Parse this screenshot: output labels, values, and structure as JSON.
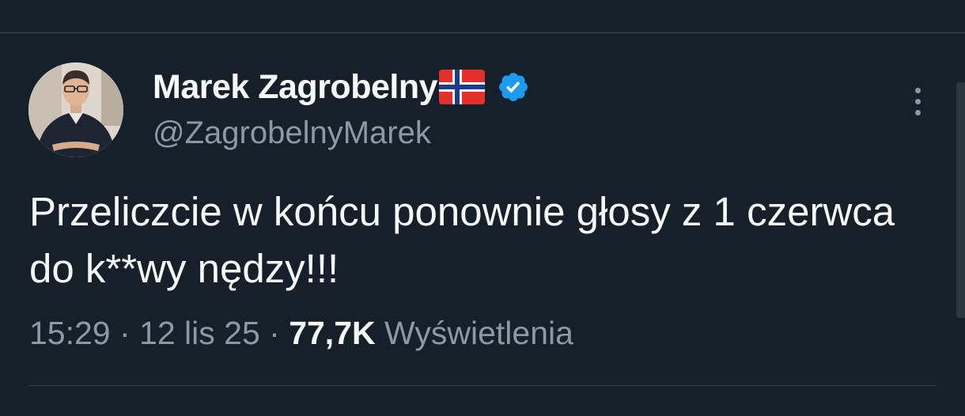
{
  "author": {
    "display_name": "Marek Zagrobelny",
    "flag_icon": "norway-flag-icon",
    "verified_icon": "verified-badge-icon",
    "verified_color": "#1d9bf0",
    "handle": "@ZagrobelnyMarek"
  },
  "tweet": {
    "text": "Przeliczcie w końcu ponownie głosy z 1 czerwca do k**wy nędzy!!!",
    "time": "15:29",
    "separator": " · ",
    "date": "12 lis 25",
    "views_count": "77,7K",
    "views_label": "Wyświetlenia"
  },
  "colors": {
    "background": "#15202b",
    "primary_text": "#f7f9f9",
    "secondary_text": "#8b98a5",
    "divider": "#38444d"
  }
}
